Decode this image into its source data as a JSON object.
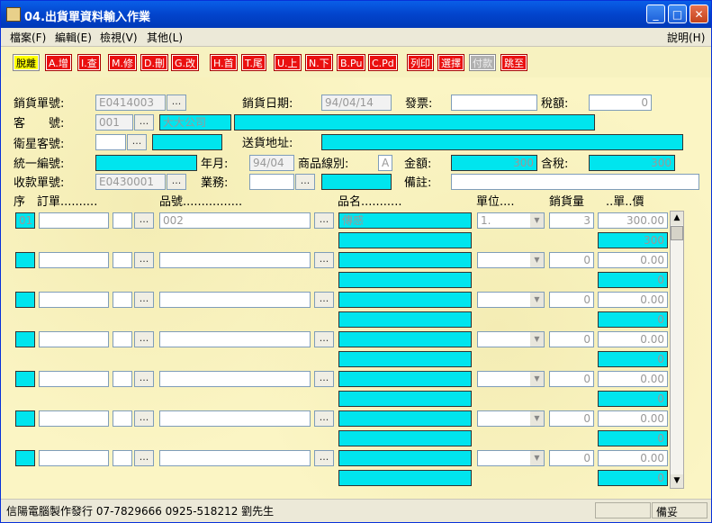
{
  "window": {
    "title": "04.出貨單資料輸入作業",
    "buttons": {
      "minimize": "_",
      "maximize": "□",
      "close": "✕"
    }
  },
  "menu": {
    "file": "檔案(F)",
    "edit": "編輯(E)",
    "view": "檢視(V)",
    "other": "其他(L)",
    "help": "說明(H)"
  },
  "toolbar": {
    "exit": "脫離",
    "add": "A.增",
    "query": "I.查",
    "modify": "M.修",
    "delete": "D.刪",
    "goto_edit": "G.改",
    "first": "H.首",
    "last": "T.尾",
    "prev": "U.上",
    "next": "N.下",
    "page_up": "B.Pu",
    "page_down": "C.Pd",
    "print": "列印",
    "select": "選擇",
    "payment": "付款",
    "jump": "跳至"
  },
  "form": {
    "sales_no_label": "銷貨單號:",
    "sales_no": "E0414003",
    "sales_date_label": "銷貨日期:",
    "sales_date": "94/04/14",
    "invoice_label": "發票:",
    "invoice": "",
    "tax_label": "稅額:",
    "tax": "0",
    "customer_label": "客　　號:",
    "customer_no": "001",
    "customer_name": "大大公司",
    "customer_extra": "",
    "sat_customer_label": "衛星客號:",
    "sat_customer_no": "",
    "sat_customer_name": "",
    "delivery_label": "送貨地址:",
    "delivery_address": "",
    "tax_id_label": "統一編號:",
    "tax_id": "",
    "ym_label": "年月:",
    "ym": "94/04",
    "product_line_label": "商品線別:",
    "product_line": "A",
    "amount_label": "金額:",
    "amount": "300",
    "incl_tax_label": "含稅:",
    "incl_tax": "300",
    "receipt_no_label": "收款單號:",
    "receipt_no": "E0430001",
    "sales_rep_label": "業務:",
    "sales_rep": "",
    "sales_rep_name": "",
    "remark_label": "備註:",
    "remark": ""
  },
  "columns": {
    "seq": "序",
    "order": "訂單..........",
    "item_no": "品號................",
    "item_name": "品名...........",
    "unit": "單位....",
    "qty": "銷貨量",
    "price": "..單..價"
  },
  "rows": [
    {
      "seq": "01",
      "order": "",
      "order2": "",
      "item_no": "002",
      "item_name": "傳感",
      "unit": "1.",
      "qty": "3",
      "price": "300.00",
      "subtotal": "300"
    },
    {
      "seq": "",
      "order": "",
      "order2": "",
      "item_no": "",
      "item_name": "",
      "unit": "",
      "qty": "0",
      "price": "0.00",
      "subtotal": "0"
    },
    {
      "seq": "",
      "order": "",
      "order2": "",
      "item_no": "",
      "item_name": "",
      "unit": "",
      "qty": "0",
      "price": "0.00",
      "subtotal": "0"
    },
    {
      "seq": "",
      "order": "",
      "order2": "",
      "item_no": "",
      "item_name": "",
      "unit": "",
      "qty": "0",
      "price": "0.00",
      "subtotal": "0"
    },
    {
      "seq": "",
      "order": "",
      "order2": "",
      "item_no": "",
      "item_name": "",
      "unit": "",
      "qty": "0",
      "price": "0.00",
      "subtotal": "0"
    },
    {
      "seq": "",
      "order": "",
      "order2": "",
      "item_no": "",
      "item_name": "",
      "unit": "",
      "qty": "0",
      "price": "0.00",
      "subtotal": "0"
    },
    {
      "seq": "",
      "order": "",
      "order2": "",
      "item_no": "",
      "item_name": "",
      "unit": "",
      "qty": "0",
      "price": "0.00",
      "subtotal": "0"
    }
  ],
  "status": {
    "vendor": "信陽電腦製作發行 07-7829666 0925-518212 劉先生",
    "state": "備妥"
  }
}
